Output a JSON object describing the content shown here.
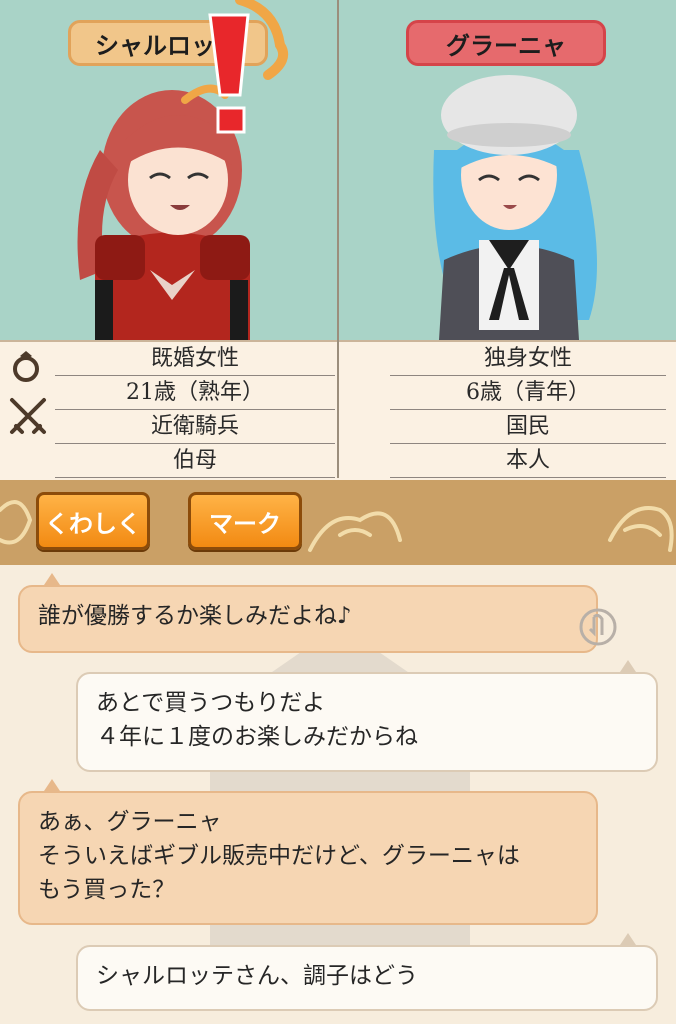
{
  "left": {
    "name": "シャルロッテ",
    "name_visible": "シャルロッ",
    "rows": [
      "既婚女性",
      "21歳（熟年）",
      "近衛騎兵",
      "伯母"
    ]
  },
  "right": {
    "name": "グラーニャ",
    "rows": [
      "独身女性",
      "6歳（青年）",
      "国民",
      "本人"
    ]
  },
  "buttons": {
    "detail": "くわしく",
    "mark": "マーク"
  },
  "messages": [
    {
      "speaker": "them",
      "lines": [
        "誰が優勝するか楽しみだよね♪"
      ]
    },
    {
      "speaker": "me",
      "lines": [
        "あとで買うつもりだよ",
        "４年に１度のお楽しみだからね"
      ]
    },
    {
      "speaker": "them",
      "lines": [
        "あぁ、グラーニャ",
        "そういえばギブル販売中だけど、グラーニャは",
        "もう買った？"
      ]
    },
    {
      "speaker": "me",
      "lines": [
        "シャルロッテさん、調子はどう"
      ]
    }
  ],
  "icons": [
    "ring-icon",
    "crossed-swords-icon",
    "exclamation-icon",
    "music-note-icon",
    "tap-hint-icon"
  ],
  "colors": {
    "portrait_bg": "#a9d3c7",
    "left_plate": "#f1c68a",
    "right_plate": "#e66a6d",
    "button": "#f5961f",
    "bar": "#caa066"
  }
}
